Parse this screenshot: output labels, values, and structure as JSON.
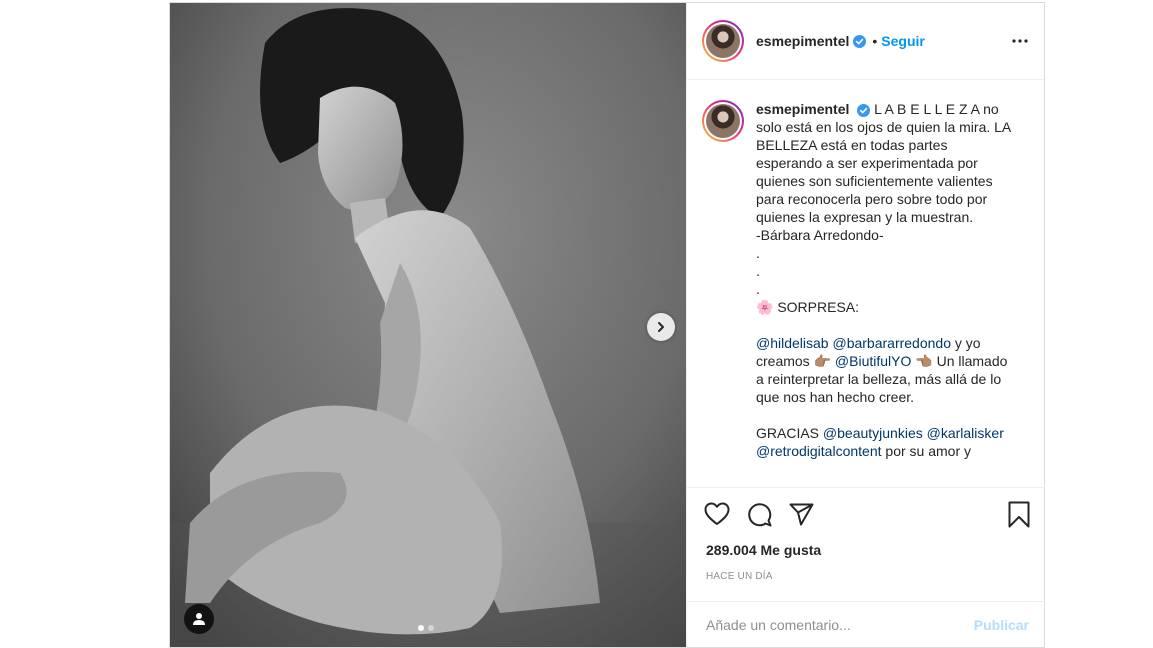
{
  "post": {
    "username": "esmepimentel",
    "follow_label": "Seguir",
    "bullet": "•",
    "caption": {
      "lines": [
        "L A B E L L E Z A no solo está en los ojos de quien la mira. LA BELLEZA está en todas partes esperando a ser experimentada por quienes son suficientemente valientes para reconocerla pero sobre todo por quienes la expresan y la muestran.",
        "-Bárbara Arredondo-",
        ".",
        ".",
        ".",
        "🌸 SORPRESA:",
        ""
      ],
      "para2_mention1": "@hildelisab",
      "para2_mention2": "@barbararredondo",
      "para2_text1": " y yo creamos 👉🏽 ",
      "para2_mention3": "@BiutifulYO",
      "para2_text2": " 👈🏽 Un llamado a reinterpretar la belleza, más allá de lo que nos han hecho creer.",
      "para3_text1": "GRACIAS ",
      "para3_mention1": "@beautyjunkies",
      "para3_mention2": "@karlalisker",
      "para3_mention3": "@retrodigitalcontent",
      "para3_text2": " por su amor y"
    },
    "likes": "289.004 Me gusta",
    "timestamp": "HACE UN DÍA",
    "comment_placeholder": "Añade un comentario...",
    "publish_label": "Publicar",
    "carousel": {
      "slides": 2,
      "current": 1
    }
  },
  "icons": {
    "verified": "verified-badge-icon",
    "more": "more-options-icon",
    "like": "heart-icon",
    "comment": "comment-bubble-icon",
    "share": "paper-plane-icon",
    "save": "bookmark-icon",
    "next": "chevron-right-icon",
    "tag": "user-tag-icon"
  },
  "colors": {
    "link": "#0095f6",
    "mention": "#00376b",
    "publish_disabled": "#b2dffc",
    "muted": "#8e8e8e"
  }
}
